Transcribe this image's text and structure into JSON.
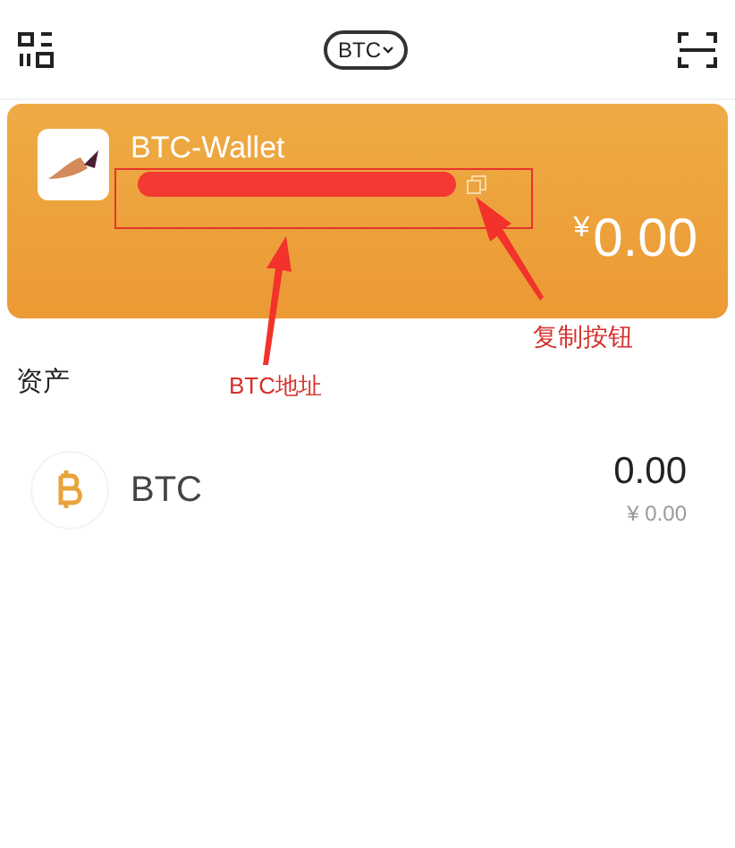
{
  "top_bar": {
    "currency_selector": "BTC"
  },
  "wallet_card": {
    "name": "BTC-Wallet",
    "address_redacted": true,
    "balance_currency": "¥",
    "balance": "0.00"
  },
  "annotations": [
    {
      "kind": "box"
    },
    {
      "kind": "label",
      "text": "BTC地址"
    },
    {
      "kind": "label",
      "text": "复制按钮"
    }
  ],
  "assets": {
    "title": "资产",
    "items": [
      {
        "symbol": "BTC",
        "amount": "0.00",
        "value": "¥ 0.00"
      }
    ]
  }
}
